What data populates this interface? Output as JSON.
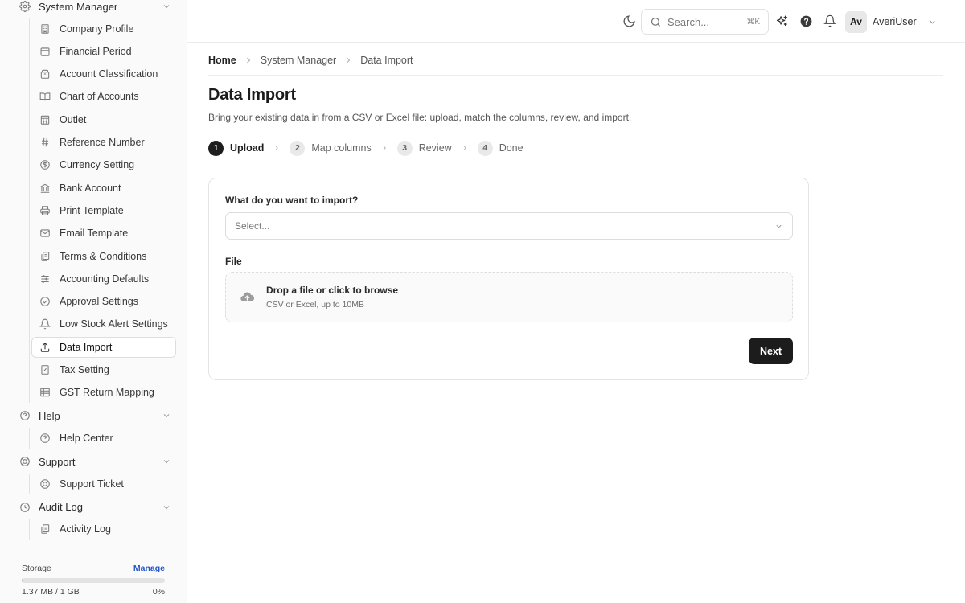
{
  "sidebar": {
    "groups": [
      {
        "label": "System Manager",
        "items": [
          {
            "label": "Company Profile"
          },
          {
            "label": "Financial Period"
          },
          {
            "label": "Account Classification"
          },
          {
            "label": "Chart of Accounts"
          },
          {
            "label": "Outlet"
          },
          {
            "label": "Reference Number"
          },
          {
            "label": "Currency Setting"
          },
          {
            "label": "Bank Account"
          },
          {
            "label": "Print Template"
          },
          {
            "label": "Email Template"
          },
          {
            "label": "Terms & Conditions"
          },
          {
            "label": "Accounting Defaults"
          },
          {
            "label": "Approval Settings"
          },
          {
            "label": "Low Stock Alert Settings"
          },
          {
            "label": "Data Import",
            "active": true
          },
          {
            "label": "Tax Setting"
          },
          {
            "label": "GST Return Mapping"
          }
        ]
      },
      {
        "label": "Help",
        "items": [
          {
            "label": "Help Center"
          }
        ]
      },
      {
        "label": "Support",
        "items": [
          {
            "label": "Support Ticket"
          }
        ]
      },
      {
        "label": "Audit Log",
        "items": [
          {
            "label": "Activity Log"
          }
        ]
      }
    ],
    "storage": {
      "label": "Storage",
      "manage_label": "Manage",
      "used_text": "1.37 MB / 1 GB",
      "percent_text": "0%",
      "fill_fraction": 0.002
    }
  },
  "topbar": {
    "search_placeholder": "Search...",
    "search_shortcut": "⌘K",
    "avatar_initials": "Av",
    "user_name": "AveriUser"
  },
  "breadcrumb": {
    "home": "Home",
    "section": "System Manager",
    "current": "Data Import"
  },
  "page": {
    "title": "Data Import",
    "subtitle": "Bring your existing data in from a CSV or Excel file: upload, match the columns, review, and import."
  },
  "steps": [
    {
      "num": "1",
      "label": "Upload",
      "current": true
    },
    {
      "num": "2",
      "label": "Map columns"
    },
    {
      "num": "3",
      "label": "Review"
    },
    {
      "num": "4",
      "label": "Done"
    }
  ],
  "form": {
    "import_label": "What do you want to import?",
    "import_value": "Select...",
    "file_label": "File",
    "drop_title": "Drop a file or click to browse",
    "drop_hint": "CSV or Excel, up to 10MB",
    "next_label": "Next"
  }
}
